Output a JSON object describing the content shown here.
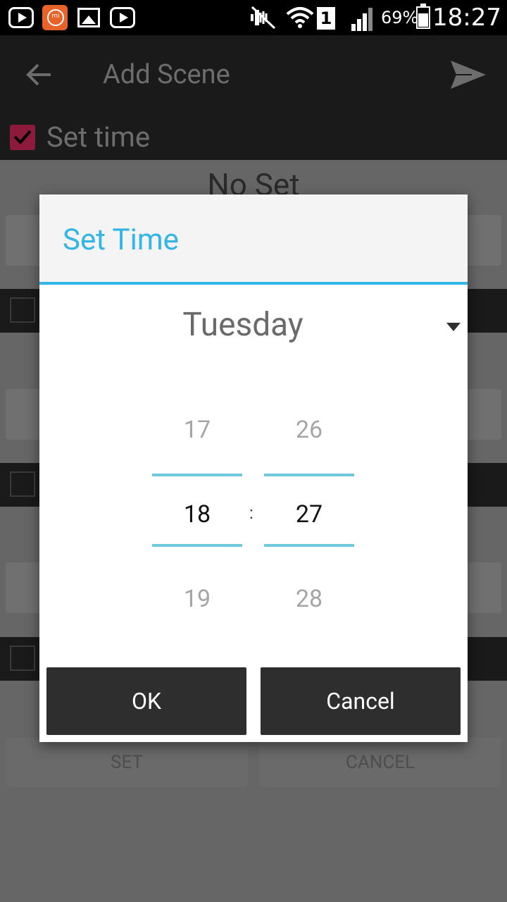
{
  "status_bar": {
    "battery_percent": "69%",
    "time": "18:27",
    "sim_slot": "1",
    "icons": [
      "youtube-icon",
      "mi-icon",
      "gallery-icon",
      "youtube-icon",
      "mute-icon",
      "wifi-icon",
      "sim-icon",
      "signal-icon",
      "battery-icon"
    ]
  },
  "app_bar": {
    "title": "Add Scene",
    "back_icon": "arrow-left-icon",
    "send_icon": "send-icon"
  },
  "set_time_row": {
    "label": "Set time",
    "checked": true
  },
  "background_content": {
    "no_set_text": "No Set",
    "set_button": "SET",
    "cancel_button": "CANCEL"
  },
  "dialog": {
    "title": "Set Time",
    "day": "Tuesday",
    "time_picker": {
      "hour": {
        "prev": "17",
        "current": "18",
        "next": "19"
      },
      "separator": ":",
      "minute": {
        "prev": "26",
        "current": "27",
        "next": "28"
      }
    },
    "ok_label": "OK",
    "cancel_label": "Cancel"
  },
  "colors": {
    "accent": "#33b5e5",
    "picker_divider": "#6fc8dc",
    "button_bg": "#2e2e2e",
    "checkbox": "#8c1a3a"
  }
}
